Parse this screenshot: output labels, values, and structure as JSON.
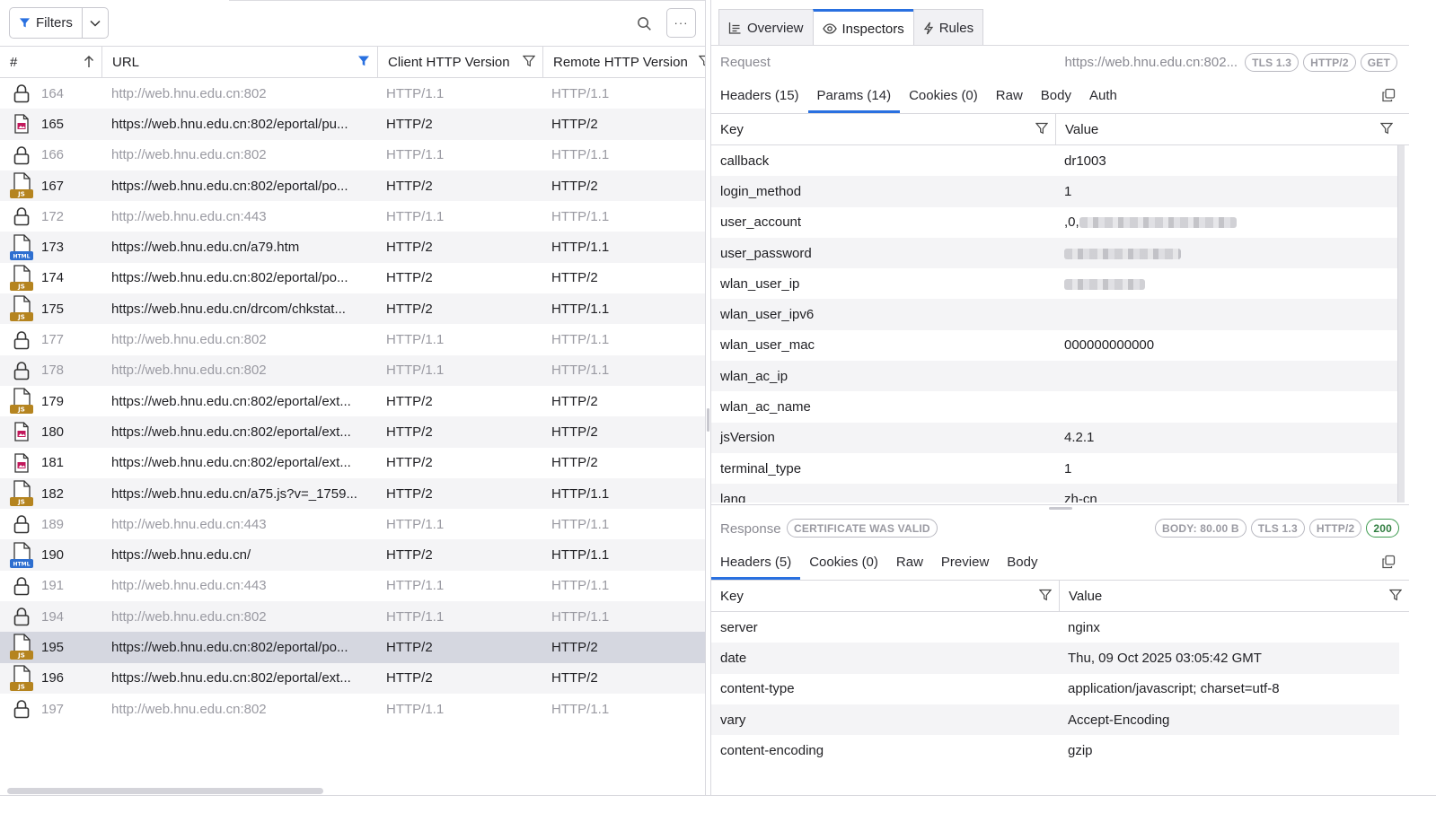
{
  "toolbar": {
    "filters_label": "Filters",
    "more_label": "···"
  },
  "columns": {
    "num": "#",
    "url": "URL",
    "client": "Client HTTP Version",
    "remote": "Remote HTTP Version"
  },
  "rows": [
    {
      "num": "164",
      "url": "http://web.hnu.edu.cn:802",
      "client": "HTTP/1.1",
      "remote": "HTTP/1.1",
      "icon": "lock",
      "dim": true
    },
    {
      "num": "165",
      "url": "https://web.hnu.edu.cn:802/eportal/pu...",
      "client": "HTTP/2",
      "remote": "HTTP/2",
      "icon": "image",
      "dim": false
    },
    {
      "num": "166",
      "url": "http://web.hnu.edu.cn:802",
      "client": "HTTP/1.1",
      "remote": "HTTP/1.1",
      "icon": "lock",
      "dim": true
    },
    {
      "num": "167",
      "url": "https://web.hnu.edu.cn:802/eportal/po...",
      "client": "HTTP/2",
      "remote": "HTTP/2",
      "icon": "js",
      "dim": false
    },
    {
      "num": "172",
      "url": "http://web.hnu.edu.cn:443",
      "client": "HTTP/1.1",
      "remote": "HTTP/1.1",
      "icon": "lock",
      "dim": true
    },
    {
      "num": "173",
      "url": "https://web.hnu.edu.cn/a79.htm",
      "client": "HTTP/2",
      "remote": "HTTP/1.1",
      "icon": "html",
      "dim": false
    },
    {
      "num": "174",
      "url": "https://web.hnu.edu.cn:802/eportal/po...",
      "client": "HTTP/2",
      "remote": "HTTP/2",
      "icon": "js",
      "dim": false
    },
    {
      "num": "175",
      "url": "https://web.hnu.edu.cn/drcom/chkstat...",
      "client": "HTTP/2",
      "remote": "HTTP/1.1",
      "icon": "js",
      "dim": false
    },
    {
      "num": "177",
      "url": "http://web.hnu.edu.cn:802",
      "client": "HTTP/1.1",
      "remote": "HTTP/1.1",
      "icon": "lock",
      "dim": true
    },
    {
      "num": "178",
      "url": "http://web.hnu.edu.cn:802",
      "client": "HTTP/1.1",
      "remote": "HTTP/1.1",
      "icon": "lock",
      "dim": true
    },
    {
      "num": "179",
      "url": "https://web.hnu.edu.cn:802/eportal/ext...",
      "client": "HTTP/2",
      "remote": "HTTP/2",
      "icon": "js",
      "dim": false
    },
    {
      "num": "180",
      "url": "https://web.hnu.edu.cn:802/eportal/ext...",
      "client": "HTTP/2",
      "remote": "HTTP/2",
      "icon": "image",
      "dim": false
    },
    {
      "num": "181",
      "url": "https://web.hnu.edu.cn:802/eportal/ext...",
      "client": "HTTP/2",
      "remote": "HTTP/2",
      "icon": "image",
      "dim": false
    },
    {
      "num": "182",
      "url": "https://web.hnu.edu.cn/a75.js?v=_1759...",
      "client": "HTTP/2",
      "remote": "HTTP/1.1",
      "icon": "js",
      "dim": false
    },
    {
      "num": "189",
      "url": "http://web.hnu.edu.cn:443",
      "client": "HTTP/1.1",
      "remote": "HTTP/1.1",
      "icon": "lock",
      "dim": true
    },
    {
      "num": "190",
      "url": "https://web.hnu.edu.cn/",
      "client": "HTTP/2",
      "remote": "HTTP/1.1",
      "icon": "html",
      "dim": false
    },
    {
      "num": "191",
      "url": "http://web.hnu.edu.cn:443",
      "client": "HTTP/1.1",
      "remote": "HTTP/1.1",
      "icon": "lock",
      "dim": true
    },
    {
      "num": "194",
      "url": "http://web.hnu.edu.cn:802",
      "client": "HTTP/1.1",
      "remote": "HTTP/1.1",
      "icon": "lock",
      "dim": true
    },
    {
      "num": "195",
      "url": "https://web.hnu.edu.cn:802/eportal/po...",
      "client": "HTTP/2",
      "remote": "HTTP/2",
      "icon": "js",
      "dim": false,
      "selected": true
    },
    {
      "num": "196",
      "url": "https://web.hnu.edu.cn:802/eportal/ext...",
      "client": "HTTP/2",
      "remote": "HTTP/2",
      "icon": "js",
      "dim": false
    },
    {
      "num": "197",
      "url": "http://web.hnu.edu.cn:802",
      "client": "HTTP/1.1",
      "remote": "HTTP/1.1",
      "icon": "lock",
      "dim": true
    }
  ],
  "icon_labels": {
    "js": "JS",
    "html": "HTML"
  },
  "inspector": {
    "tabs": [
      {
        "label": "Overview",
        "icon": "list-icon",
        "active": false
      },
      {
        "label": "Inspectors",
        "icon": "eye-icon",
        "active": true
      },
      {
        "label": "Rules",
        "icon": "lightning-icon",
        "active": false
      }
    ]
  },
  "request": {
    "title": "Request",
    "url": "https://web.hnu.edu.cn:802...",
    "badges": [
      "TLS 1.3",
      "HTTP/2",
      "GET"
    ],
    "subtabs": [
      {
        "label": "Headers (15)",
        "active": false
      },
      {
        "label": "Params (14)",
        "active": true
      },
      {
        "label": "Cookies (0)",
        "active": false
      },
      {
        "label": "Raw",
        "active": false
      },
      {
        "label": "Body",
        "active": false
      },
      {
        "label": "Auth",
        "active": false
      }
    ],
    "key_header": "Key",
    "value_header": "Value",
    "params": [
      {
        "key": "callback",
        "value": "dr1003"
      },
      {
        "key": "login_method",
        "value": "1"
      },
      {
        "key": "user_account",
        "value": ",0,",
        "blurred": 175
      },
      {
        "key": "user_password",
        "value": "",
        "blurred": 130
      },
      {
        "key": "wlan_user_ip",
        "value": "",
        "blurred": 90
      },
      {
        "key": "wlan_user_ipv6",
        "value": ""
      },
      {
        "key": "wlan_user_mac",
        "value": "000000000000"
      },
      {
        "key": "wlan_ac_ip",
        "value": ""
      },
      {
        "key": "wlan_ac_name",
        "value": ""
      },
      {
        "key": "jsVersion",
        "value": "4.2.1"
      },
      {
        "key": "terminal_type",
        "value": "1"
      },
      {
        "key": "lang",
        "value": "zh-cn"
      }
    ]
  },
  "response": {
    "title": "Response",
    "cert_badge": "CERTIFICATE WAS VALID",
    "badges": [
      "BODY: 80.00 B",
      "TLS 1.3",
      "HTTP/2"
    ],
    "status": "200",
    "subtabs": [
      {
        "label": "Headers (5)",
        "active": true
      },
      {
        "label": "Cookies (0)",
        "active": false
      },
      {
        "label": "Raw",
        "active": false
      },
      {
        "label": "Preview",
        "active": false
      },
      {
        "label": "Body",
        "active": false
      }
    ],
    "key_header": "Key",
    "value_header": "Value",
    "headers": [
      {
        "key": "server",
        "value": "nginx"
      },
      {
        "key": "date",
        "value": "Thu, 09 Oct 2025 03:05:42 GMT"
      },
      {
        "key": "content-type",
        "value": "application/javascript; charset=utf-8"
      },
      {
        "key": "vary",
        "value": "Accept-Encoding"
      },
      {
        "key": "content-encoding",
        "value": "gzip"
      }
    ]
  },
  "colors": {
    "accent": "#2970e0",
    "selected_row": "#d5d7e0",
    "js_badge": "#b5841f",
    "html_badge": "#2e6fd0",
    "image_icon": "#c2185b",
    "status_ok": "#2f7d3f"
  }
}
